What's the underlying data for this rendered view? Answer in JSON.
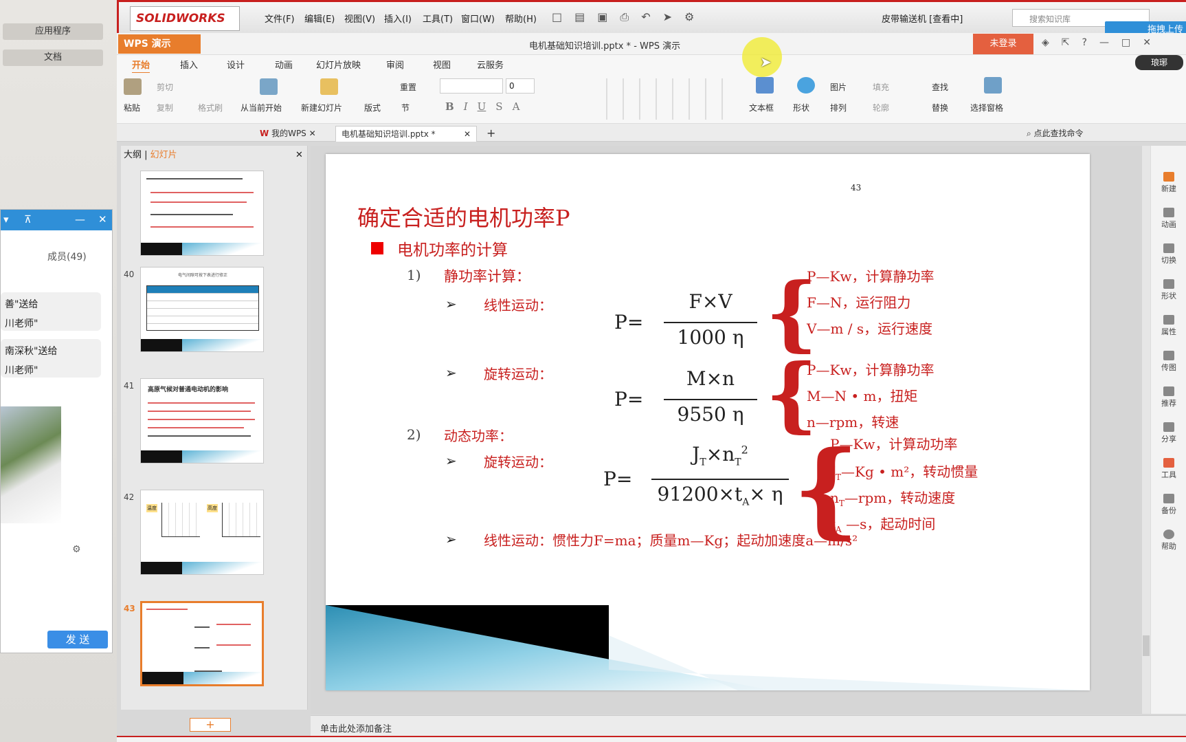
{
  "side_buttons": [
    "应用程序",
    "文档"
  ],
  "chat": {
    "members": "成员(49)",
    "messages": [
      {
        "line1": "善\"送给",
        "line2": "川老师\""
      },
      {
        "line1": "南深秋\"送给",
        "line2": "川老师\""
      }
    ],
    "send_label": "发 送"
  },
  "solidworks": {
    "logo": "SOLIDWORKS",
    "menus": [
      "文件(F)",
      "编辑(E)",
      "视图(V)",
      "插入(I)",
      "工具(T)",
      "窗口(W)",
      "帮助(H)"
    ],
    "doc_title": "皮带输送机 [查看中]",
    "search_placeholder": "搜索知识库",
    "upload_label": "拖拽上传"
  },
  "wps": {
    "app_button": "WPS 演示",
    "title": "电机基础知识培训.pptx * - WPS 演示",
    "login": "未登录",
    "user_badge": "琅琊",
    "tabs": [
      "开始",
      "插入",
      "设计",
      "动画",
      "幻灯片放映",
      "审阅",
      "视图",
      "云服务"
    ],
    "active_tab": "开始",
    "ribbon": {
      "paste": "粘贴",
      "cut": "剪切",
      "copy": "复制",
      "format_painter": "格式刷",
      "from_current": "从当前开始",
      "new_slide": "新建幻灯片",
      "layout": "版式",
      "reset": "重置",
      "section": "节",
      "font_size": "0",
      "text_box": "文本框",
      "shape": "形状",
      "picture": "图片",
      "arrange": "排列",
      "fill": "填充",
      "outline": "轮廓",
      "find": "查找",
      "replace": "替换",
      "selection_pane": "选择窗格"
    },
    "doc_tabs": [
      "我的WPS",
      "电机基础知识培训.pptx *"
    ],
    "find_command": "点此查找命令",
    "pane_tabs": [
      "大纲",
      "幻灯片"
    ],
    "notes_placeholder": "单击此处添加备注"
  },
  "thumbnails": [
    {
      "num": ""
    },
    {
      "num": "40",
      "title": "电气间隙可按下表进行修正"
    },
    {
      "num": "41",
      "title": "高原气候对普通电动机的影响"
    },
    {
      "num": "42",
      "labels": [
        "温度",
        "高度"
      ]
    },
    {
      "num": "43"
    }
  ],
  "slide": {
    "page_number": "43",
    "title": "确定合适的电机功率P",
    "bullet": "电机功率的计算",
    "sec1_num": "1)",
    "sec1": "静功率计算：",
    "linear": "线性运动：",
    "rotary": "旋转运动：",
    "sec2_num": "2)",
    "sec2": "动态功率：",
    "rotary2": "旋转运动：",
    "footer_line": "线性运动：惯性力F=ma；质量m—Kg；起动加速度a—m/s²",
    "f1": {
      "lhs": "P=",
      "num": "F×V",
      "den": "1000 η"
    },
    "f1_legend": [
      "P—Kw，计算静功率",
      "F—N，运行阻力",
      "V—m / s，运行速度"
    ],
    "f2": {
      "lhs": "P=",
      "num": "M×n",
      "den": "9550 η"
    },
    "f2_legend": [
      "P—Kw，计算静功率",
      "M—N • m，扭矩",
      "n—rpm，转速"
    ],
    "f3": {
      "lhs": "P=",
      "num": "J",
      "num_sub1": "T",
      "num_mid": "×n",
      "num_sub2": "T",
      "num_sup": "2",
      "den": "91200×t",
      "den_sub": "A",
      "den_tail": "× η"
    },
    "f3_legend": [
      "P—Kw，计算动功率",
      "J",
      "T",
      "—Kg • m²，转动惯量",
      "n",
      "T",
      "—rpm，转动速度",
      "t",
      "A",
      " —s，起动时间"
    ]
  },
  "right_bar": [
    "新建",
    "动画",
    "切换",
    "形状",
    "属性",
    "传图",
    "推荐",
    "分享",
    "工具",
    "备份",
    "帮助"
  ],
  "colors": {
    "accent": "#e87d2c",
    "slide_red": "#c8201f",
    "chat_blue": "#2f8fd8"
  }
}
